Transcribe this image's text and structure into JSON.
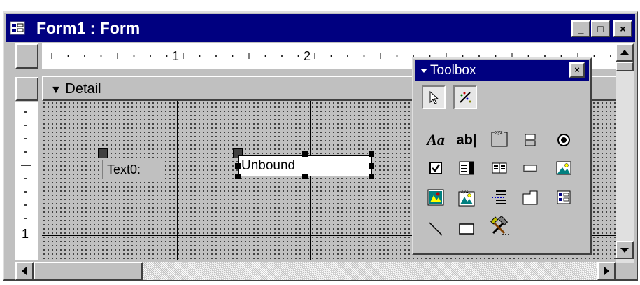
{
  "window": {
    "title": "Form1 : Form",
    "title_icon": "form-icon",
    "minimize_glyph": "_",
    "restore_glyph": "□",
    "close_glyph": "×"
  },
  "ruler": {
    "marks": [
      "1",
      "2"
    ],
    "vertical_marks": [
      "1"
    ]
  },
  "section": {
    "label": "Detail"
  },
  "controls": {
    "label_text": "Text0:",
    "textbox_text": "Unbound"
  },
  "toolbox": {
    "title": "Toolbox",
    "close_glyph": "×",
    "rows": [
      [
        {
          "name": "select-objects-tool-icon"
        },
        {
          "name": "control-wizards-tool-icon"
        }
      ],
      [
        {
          "name": "label-tool-icon",
          "text": "Aa"
        },
        {
          "name": "text-box-tool-icon",
          "text": "ab|"
        },
        {
          "name": "option-group-tool-icon",
          "text": "xyz"
        },
        {
          "name": "toggle-button-tool-icon"
        },
        {
          "name": "option-button-tool-icon"
        }
      ],
      [
        {
          "name": "check-box-tool-icon"
        },
        {
          "name": "combo-box-tool-icon"
        },
        {
          "name": "list-box-tool-icon"
        },
        {
          "name": "command-button-tool-icon"
        },
        {
          "name": "image-tool-icon"
        }
      ],
      [
        {
          "name": "unbound-object-frame-tool-icon"
        },
        {
          "name": "bound-object-frame-tool-icon",
          "text": "xyz"
        },
        {
          "name": "page-break-tool-icon"
        },
        {
          "name": "tab-control-tool-icon"
        },
        {
          "name": "subform-tool-icon"
        }
      ],
      [
        {
          "name": "line-tool-icon"
        },
        {
          "name": "rectangle-tool-icon"
        },
        {
          "name": "more-controls-tool-icon"
        }
      ]
    ]
  },
  "colors": {
    "titlebar": "#000080",
    "face": "#c0c0c0"
  }
}
